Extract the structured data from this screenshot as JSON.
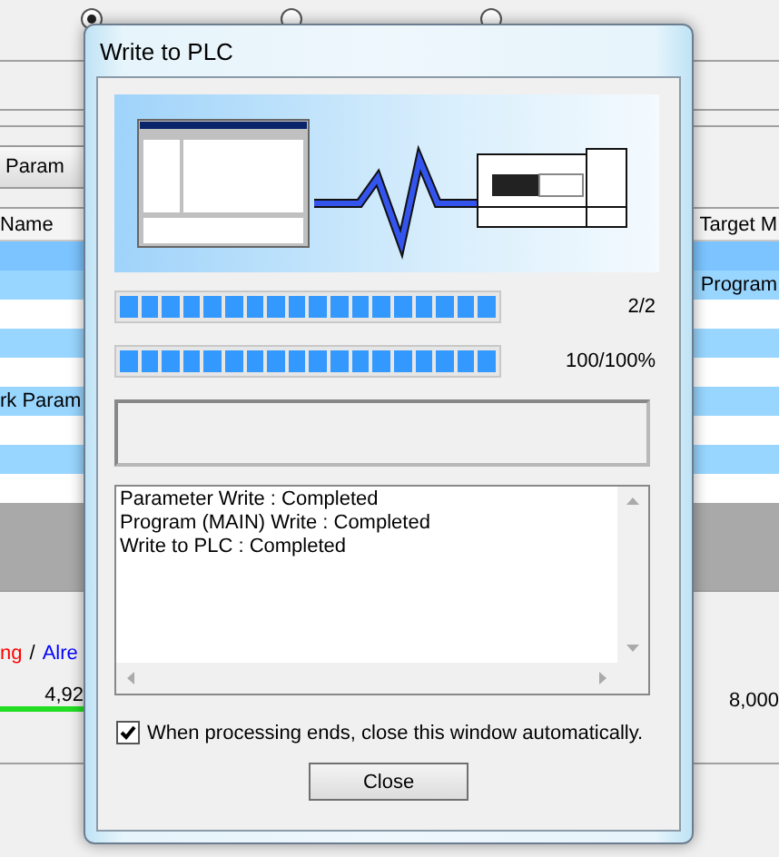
{
  "background": {
    "modes": [
      {
        "selected": true
      },
      {
        "selected": false
      },
      {
        "selected": false
      }
    ],
    "toolbar_button": "Param",
    "table": {
      "name_header": "Name",
      "target_header": "Target M",
      "rows": [
        {
          "name": "",
          "target": "",
          "selected": true
        },
        {
          "name": "",
          "target": "Program",
          "selected": false
        },
        {
          "name": "",
          "target": "",
          "selected": false
        },
        {
          "name": "",
          "target": "",
          "selected": false
        },
        {
          "name": "",
          "target": "",
          "selected": false
        },
        {
          "name": "rk Param",
          "target": "",
          "selected": false
        },
        {
          "name": "",
          "target": "",
          "selected": false
        },
        {
          "name": "",
          "target": "",
          "selected": false
        },
        {
          "name": "",
          "target": "",
          "selected": false
        }
      ]
    },
    "legend": [
      {
        "label": "ng",
        "color": "#ff0000"
      },
      {
        "label": "/",
        "color": "#000000"
      },
      {
        "label": "Alre",
        "color": "#0000ff"
      }
    ],
    "used_size": "4,92",
    "total_size": "8,000"
  },
  "dialog": {
    "title": "Write to PLC",
    "progress": [
      {
        "reading": "2/2"
      },
      {
        "reading": "100/100%"
      }
    ],
    "log": [
      "Parameter Write : Completed",
      "Program (MAIN) Write : Completed",
      "Write to PLC : Completed"
    ],
    "auto_close": {
      "label": "When processing ends, close this window automatically.",
      "checked": true
    },
    "close_button": "Close"
  }
}
